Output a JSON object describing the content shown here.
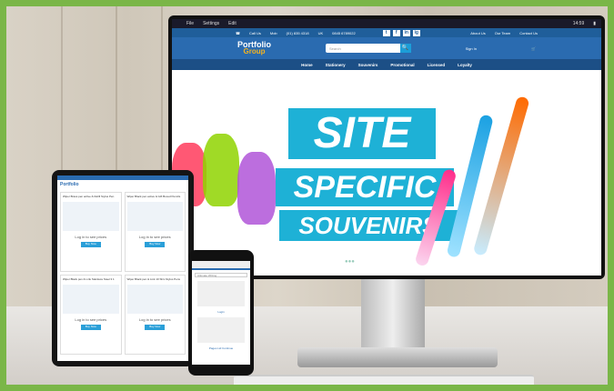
{
  "desktop": {
    "os_menu": [
      "File",
      "Settings",
      "Edit"
    ],
    "os_time": "14:59",
    "site_top": {
      "call": "Call Us",
      "phone_mobile": "(01) 835 4318",
      "phone_uk": "0845 6789022",
      "mob_label": "Mob",
      "uk_label": "UK",
      "social": [
        "t",
        "f",
        "in",
        "ig"
      ],
      "links": [
        "About Us",
        "Our Team",
        "Contact Us"
      ]
    },
    "logo": {
      "line1": "Portfolio",
      "line2": "Group"
    },
    "search": {
      "placeholder": "Search",
      "button": "🔍"
    },
    "signin": "Sign In",
    "nav": [
      "Home",
      "Stationery",
      "Souvenirs",
      "Promotional",
      "Licensed",
      "Loyalty"
    ],
    "hero": {
      "line1": "SITE",
      "line2": "SPECIFIC",
      "line3": "SOUVENIRS"
    }
  },
  "tablet": {
    "title": "Portfolio",
    "cards": [
      {
        "title": "Wiper Brass pen active & Refill Stylus Pen",
        "login": "Log in to see prices",
        "button": "Buy Now"
      },
      {
        "title": "Wiper Black pen active & Gift Boxed Pencils",
        "login": "Log in to see prices",
        "button": "Buy Now"
      },
      {
        "title": "Wiper Black pen & Link Stainless Steel 3 1",
        "login": "Log in to see prices",
        "button": "Buy Now"
      },
      {
        "title": "Wiper Black pen & Link 10 Slim Stylus Pens",
        "login": "Log in to see prices",
        "button": "Buy Now"
      }
    ]
  },
  "phone": {
    "search_placeholder": "Ultimate Writing",
    "link1": "Login",
    "link2": "Pages Ltd Continue"
  }
}
